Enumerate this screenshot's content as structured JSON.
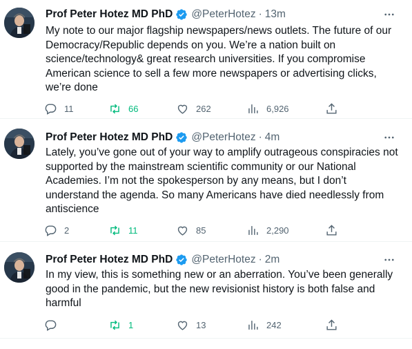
{
  "tweets": [
    {
      "author": "Prof Peter Hotez MD PhD",
      "handle": "@PeterHotez",
      "separator": "·",
      "time": "13m",
      "text": "My note to our major flagship newspapers/news outlets. The future of our Democracy/Republic depends on you. We’re a nation built on science/technology& great research universities. If you compromise American science to sell a few more newspapers or advertising clicks, we’re done",
      "replies": "11",
      "retweets": "66",
      "likes": "262",
      "views": "6,926"
    },
    {
      "author": "Prof Peter Hotez MD PhD",
      "handle": "@PeterHotez",
      "separator": "·",
      "time": "4m",
      "text": "Lately, you’ve gone out of your way to amplify outrageous conspiracies not supported by the mainstream scientific community or our National Academies. I’m not the spokesperson by any means, but I don’t understand the agenda. So many Americans have died needlessly from antiscience",
      "replies": "2",
      "retweets": "11",
      "likes": "85",
      "views": "2,290"
    },
    {
      "author": "Prof Peter Hotez MD PhD",
      "handle": "@PeterHotez",
      "separator": "·",
      "time": "2m",
      "text": "In my view, this is something new or an aberration. You’ve been generally good in the pandemic, but the new revisionist history is both false and harmful",
      "replies": "",
      "retweets": "1",
      "likes": "13",
      "views": "242"
    }
  ],
  "colors": {
    "text": "#0f1419",
    "secondary": "#536471",
    "verified": "#1d9bf0",
    "retweet": "#00ba7c",
    "divider": "#eff3f4"
  },
  "icons": {
    "verified": "verified-badge-icon",
    "more": "more-options-icon",
    "reply": "reply-icon",
    "retweet": "retweet-icon",
    "like": "like-heart-icon",
    "views": "views-chart-icon",
    "share": "share-icon"
  }
}
